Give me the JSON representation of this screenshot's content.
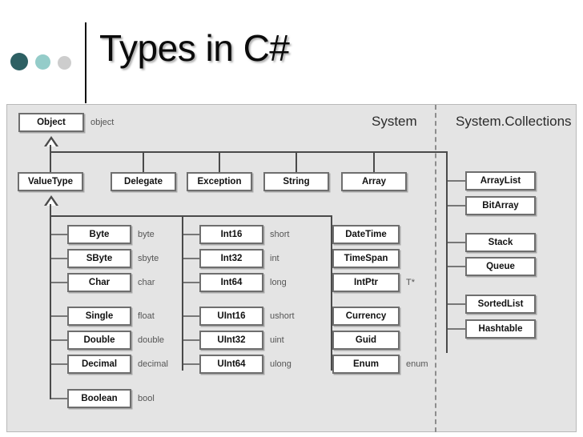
{
  "slide": {
    "title": "Types in C#",
    "accent_dark": "#2d6063",
    "accent_mid": "#94ccc9",
    "accent_light": "#cdcdcd"
  },
  "diagram": {
    "namespaces": {
      "system": "System",
      "collections": "System.Collections"
    },
    "root": {
      "name": "Object",
      "alias": "object"
    },
    "level2": [
      {
        "name": "ValueType",
        "alias": ""
      },
      {
        "name": "Delegate",
        "alias": ""
      },
      {
        "name": "Exception",
        "alias": ""
      },
      {
        "name": "String",
        "alias": ""
      },
      {
        "name": "Array",
        "alias": ""
      }
    ],
    "value_types_col1": [
      {
        "name": "Byte",
        "alias": "byte"
      },
      {
        "name": "SByte",
        "alias": "sbyte"
      },
      {
        "name": "Char",
        "alias": "char"
      },
      {
        "name": "Single",
        "alias": "float"
      },
      {
        "name": "Double",
        "alias": "double"
      },
      {
        "name": "Decimal",
        "alias": "decimal"
      },
      {
        "name": "Boolean",
        "alias": "bool"
      }
    ],
    "value_types_col2": [
      {
        "name": "Int16",
        "alias": "short"
      },
      {
        "name": "Int32",
        "alias": "int"
      },
      {
        "name": "Int64",
        "alias": "long"
      },
      {
        "name": "UInt16",
        "alias": "ushort"
      },
      {
        "name": "UInt32",
        "alias": "uint"
      },
      {
        "name": "UInt64",
        "alias": "ulong"
      }
    ],
    "value_types_col3": [
      {
        "name": "DateTime",
        "alias": ""
      },
      {
        "name": "TimeSpan",
        "alias": ""
      },
      {
        "name": "IntPtr",
        "alias": "T*"
      },
      {
        "name": "Currency",
        "alias": ""
      },
      {
        "name": "Guid",
        "alias": ""
      },
      {
        "name": "Enum",
        "alias": "enum"
      }
    ],
    "collections": [
      {
        "name": "ArrayList",
        "alias": ""
      },
      {
        "name": "BitArray",
        "alias": ""
      },
      {
        "name": "Stack",
        "alias": ""
      },
      {
        "name": "Queue",
        "alias": ""
      },
      {
        "name": "SortedList",
        "alias": ""
      },
      {
        "name": "Hashtable",
        "alias": ""
      }
    ]
  }
}
